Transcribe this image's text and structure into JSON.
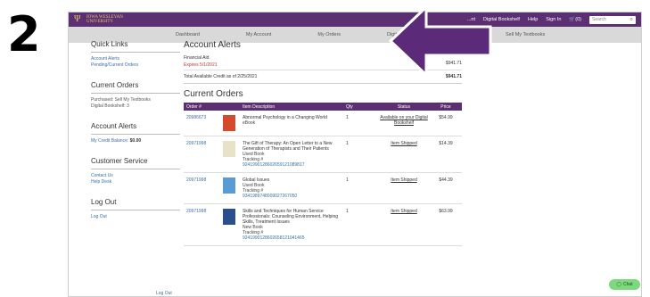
{
  "step": "2",
  "brand": {
    "line1": "IOWA WESLEYAN",
    "line2": "UNIVERSITY"
  },
  "topnav": {
    "items": [
      "...nt",
      "Digital Bookshelf",
      "Help",
      "Sign In",
      "(0)"
    ],
    "search_placeholder": "Search"
  },
  "subnav": [
    "Dashboard",
    "My Account",
    "My Orders",
    "Digital Bookshelf",
    "Sell My Textbooks"
  ],
  "sidebar": {
    "quick_links": {
      "title": "Quick Links",
      "items": [
        "Account Alerts",
        "Pending/Current Orders"
      ]
    },
    "current_orders": {
      "title": "Current Orders",
      "lines": [
        "Purchased: Sell My Textbooks",
        "Digital Bookshelf: 3"
      ]
    },
    "account_alerts": {
      "title": "Account Alerts",
      "balance_label": "My Credit Balance:",
      "balance": "$0.00"
    },
    "customer_service": {
      "title": "Customer Service",
      "items": [
        "Contact Us",
        "Help Desk"
      ]
    },
    "logout": {
      "title": "Log Out",
      "item": "Log Out"
    },
    "bottom": "Log Out"
  },
  "alerts": {
    "title": "Account Alerts",
    "financial_aid_label": "Financial Aid",
    "expires": "Expires 5/1/2021",
    "amount": "$941.71",
    "total_label": "Total Available Credit as of 2/25/2021",
    "total_amount": "$941.71"
  },
  "orders": {
    "title": "Current Orders",
    "headers": [
      "Order #",
      "Item Description",
      "Qty",
      "Status",
      "Price"
    ],
    "rows": [
      {
        "order": "20986673",
        "title": "Abnormal Psychology in a Changing World",
        "sub": "eBook",
        "tracking_label": "",
        "tracking": "",
        "qty": "1",
        "status": "Available on your Digital Bookshelf",
        "price": "$54.99",
        "cover_color": "#d44a2a"
      },
      {
        "order": "20971998",
        "title": "The Gift of Therapy: An Open Letter to a New Generation of Therapists and Their Patients",
        "sub": "Used Book",
        "tracking_label": "Tracking #",
        "tracking": "9241990128602659121089817",
        "qty": "1",
        "status": "Item Shipped",
        "price": "$14.39",
        "cover_color": "#e8e2c8"
      },
      {
        "order": "20971998",
        "title": "Global Issues",
        "sub": "Used Book",
        "tracking_label": "Tracking #",
        "tracking": "9341989748009027267050",
        "qty": "1",
        "status": "Item Shipped",
        "price": "$44.39",
        "cover_color": "#5a9bd4"
      },
      {
        "order": "20971998",
        "title": "Skills and Techniques for Human Service Professionals: Counseling Environment, Helping Skills, Treatment Issues",
        "sub": "New Book",
        "tracking_label": "Tracking #",
        "tracking": "9241990128602658121041465",
        "qty": "1",
        "status": "Item Shipped",
        "price": "$63.99",
        "cover_color": "#2b4f8a"
      }
    ]
  },
  "chat": {
    "label": "Chat"
  },
  "colors": {
    "brand_purple": "#5c2f73",
    "arrow": "#5b2a78",
    "chat_green": "#7ed87e"
  }
}
